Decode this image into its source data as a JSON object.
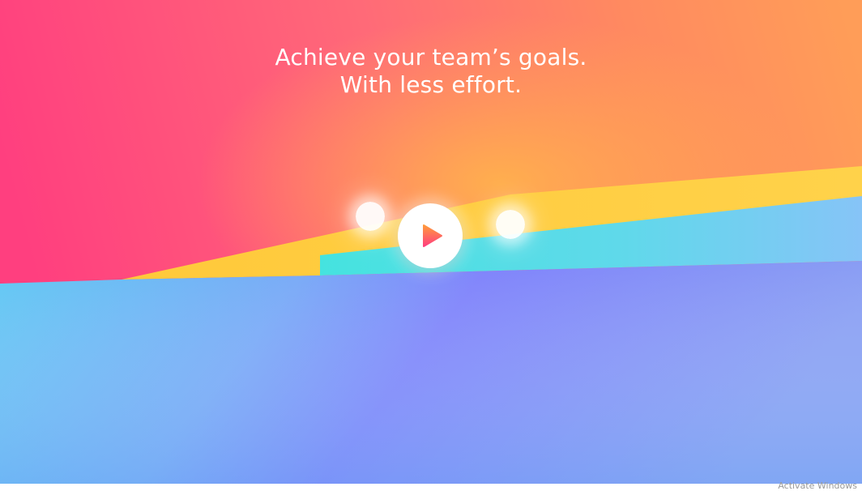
{
  "hero": {
    "headline_line1": "Achieve your team’s goals.",
    "headline_line2": "With less effort."
  },
  "video": {
    "play_icon": "play-icon"
  },
  "watermark": {
    "text": "Activate Windows"
  },
  "colors": {
    "pink": "#ff3f7f",
    "coral": "#ff7a6a",
    "orange": "#ff9d58",
    "yellow": "#ffc93a",
    "cyan": "#4fe1e3",
    "sky": "#62c3f5",
    "periwinkle": "#7e84fb",
    "play_gradient_start": "#ff9a3c",
    "play_gradient_end": "#ff3f7f"
  }
}
